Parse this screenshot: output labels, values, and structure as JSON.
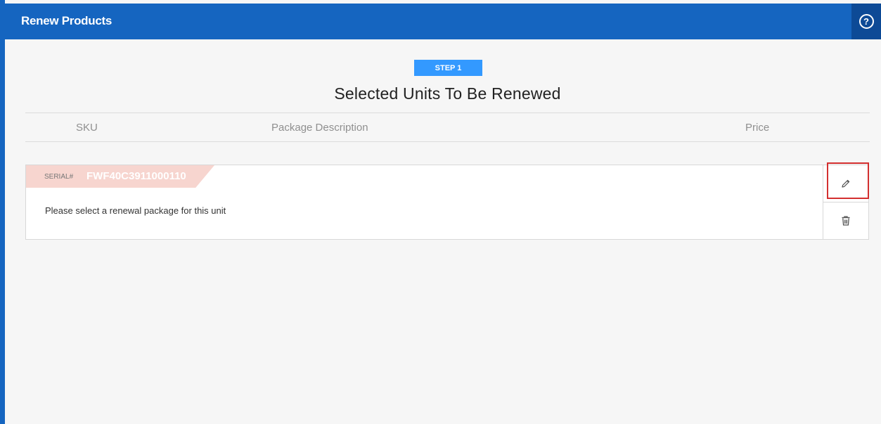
{
  "header": {
    "title": "Renew Products",
    "help_icon": "help-circle-icon"
  },
  "step": {
    "badge": "STEP 1",
    "title": "Selected Units To Be Renewed"
  },
  "table": {
    "columns": [
      "SKU",
      "Package Description",
      "Price"
    ]
  },
  "unit": {
    "serial_label": "SERIAL#",
    "serial_value": "FWF40C3911000110",
    "message": "Please select a renewal package for this unit",
    "actions": {
      "edit_icon": "pencil-icon",
      "delete_icon": "trash-icon"
    }
  },
  "colors": {
    "header_bg": "#1565c0",
    "help_bg": "#0d4a96",
    "step_badge": "#3399ff",
    "serial_tab": "#f7d5cf",
    "highlight": "#d32f2f"
  }
}
